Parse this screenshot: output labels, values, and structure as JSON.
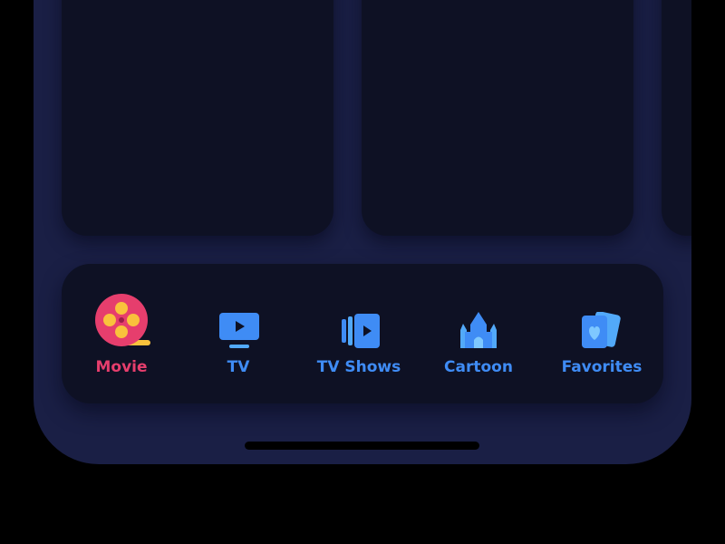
{
  "tab_bar": {
    "tabs": [
      {
        "label": "Movie",
        "icon": "film-reel-icon",
        "active": true
      },
      {
        "label": "TV",
        "icon": "tv-icon",
        "active": false
      },
      {
        "label": "TV Shows",
        "icon": "tv-shows-icon",
        "active": false
      },
      {
        "label": "Cartoon",
        "icon": "castle-icon",
        "active": false
      },
      {
        "label": "Favorites",
        "icon": "heart-cards-icon",
        "active": false
      }
    ]
  },
  "colors": {
    "background": "#000000",
    "device": "#1a1f45",
    "surface": "#0e1124",
    "active": "#e63e6d",
    "inactive": "#3f8cf5",
    "reel_holes": "#f9c23c"
  }
}
